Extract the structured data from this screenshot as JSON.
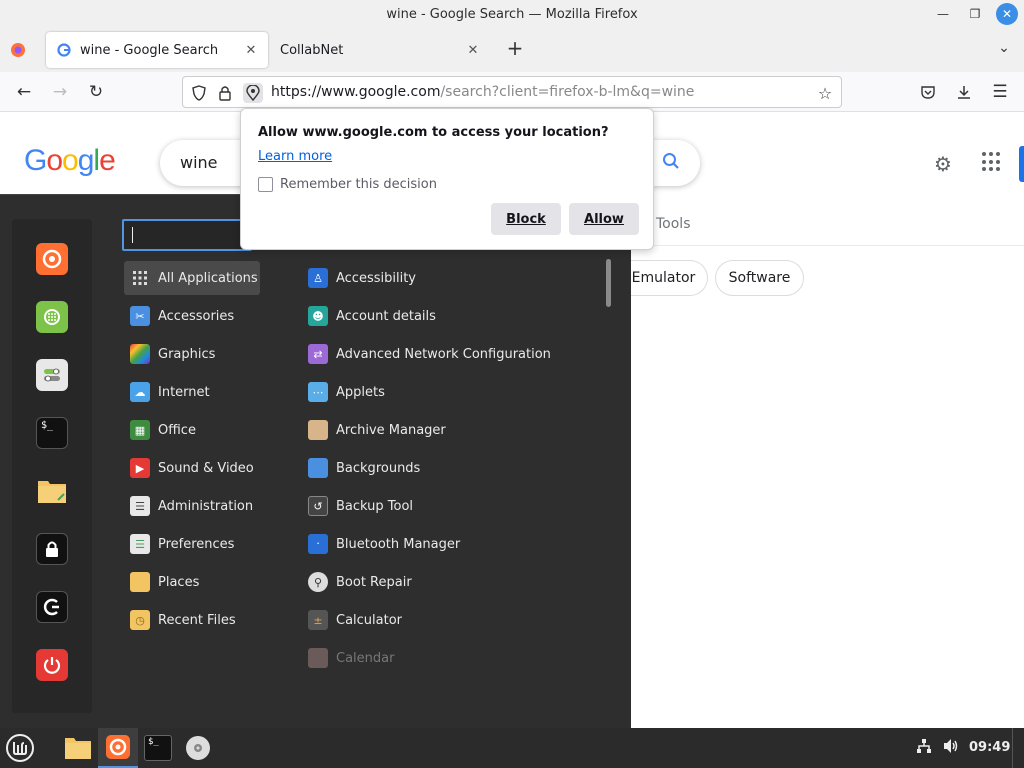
{
  "window": {
    "title": "wine - Google Search — Mozilla Firefox"
  },
  "tabs": [
    {
      "label": "wine - Google Search"
    },
    {
      "label": "CollabNet"
    }
  ],
  "urlbar": {
    "url_domain": "https://www.google.com",
    "url_rest": "/search?client=firefox-b-lm&q=wine"
  },
  "google": {
    "logo": "Google",
    "query": "wine",
    "tools": "Tools",
    "chips": [
      "Emulator",
      "Software"
    ]
  },
  "popup": {
    "question": "Allow www.google.com to access your location?",
    "learn_more": "Learn more",
    "remember": "Remember this decision",
    "block": "Block",
    "allow": "Allow"
  },
  "menu": {
    "categories": [
      "All Applications",
      "Accessories",
      "Graphics",
      "Internet",
      "Office",
      "Sound & Video",
      "Administration",
      "Preferences",
      "Places",
      "Recent Files"
    ],
    "apps": [
      "Accessibility",
      "Account details",
      "Advanced Network Configuration",
      "Applets",
      "Archive Manager",
      "Backgrounds",
      "Backup Tool",
      "Bluetooth Manager",
      "Boot Repair",
      "Calculator",
      "Calendar"
    ]
  },
  "taskbar": {
    "clock": "09:49"
  },
  "colors": {
    "accent": "#5294e2",
    "menu_bg": "#2e2e2e",
    "google_blue": "#4285f4"
  }
}
